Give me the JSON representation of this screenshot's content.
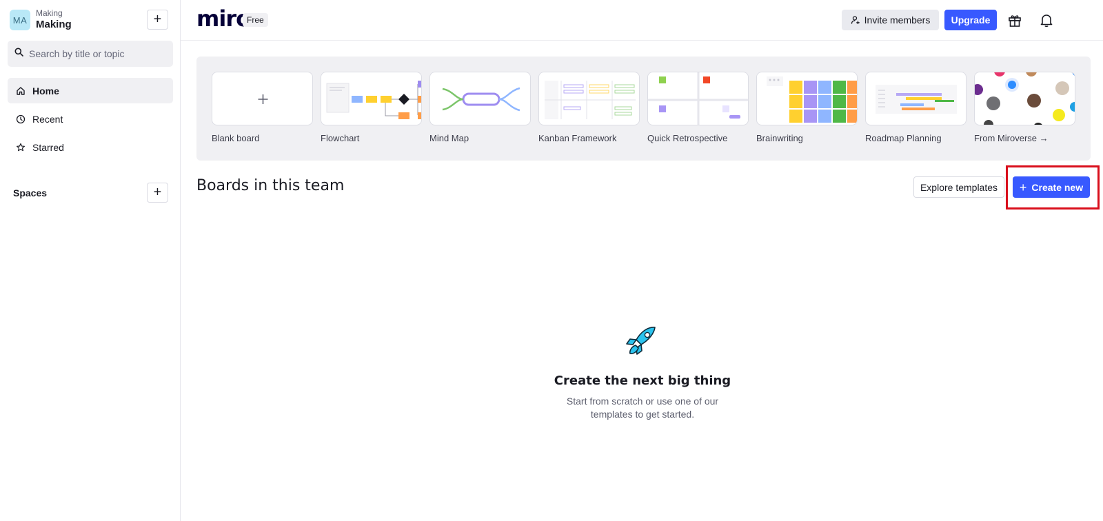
{
  "sidebar": {
    "team": {
      "avatar_initials": "MA",
      "subtitle": "Making",
      "name": "Making"
    },
    "add_label": "+",
    "search": {
      "placeholder": "Search by title or topic"
    },
    "nav": [
      {
        "label": "Home",
        "icon": "home-icon"
      },
      {
        "label": "Recent",
        "icon": "clock-icon"
      },
      {
        "label": "Starred",
        "icon": "star-icon"
      }
    ],
    "spaces_label": "Spaces",
    "spaces_add_label": "+"
  },
  "header": {
    "logo": "miro",
    "plan": "Free",
    "invite_label": "Invite members",
    "upgrade_label": "Upgrade"
  },
  "templates": [
    {
      "label": "Blank board",
      "thumb": "plus"
    },
    {
      "label": "Flowchart",
      "thumb": "flowchart"
    },
    {
      "label": "Mind Map",
      "thumb": "mindmap"
    },
    {
      "label": "Kanban Framework",
      "thumb": "kanban"
    },
    {
      "label": "Quick Retrospective",
      "thumb": "retro"
    },
    {
      "label": "Brainwriting",
      "thumb": "brainwriting"
    },
    {
      "label": "Roadmap Planning",
      "thumb": "roadmap"
    },
    {
      "label": "From Miroverse →",
      "thumb": "miroverse"
    }
  ],
  "boards": {
    "title": "Boards in this team",
    "explore_label": "Explore templates",
    "create_label": "Create new",
    "create_plus": "+"
  },
  "empty_state": {
    "title": "Create the next big thing",
    "description": "Start from scratch or use one of our templates to get started."
  },
  "colors": {
    "accent": "#3859ff",
    "highlight": "#d90e1b"
  }
}
